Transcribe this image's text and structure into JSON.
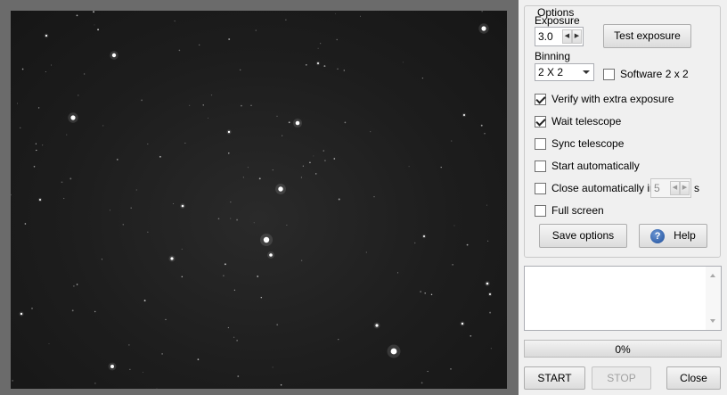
{
  "options": {
    "group_title": "Options",
    "exposure_label": "Exposure",
    "exposure_value": "3.0",
    "test_exposure_label": "Test exposure",
    "binning_label": "Binning",
    "binning_value": "2 X 2",
    "software_binning": {
      "label": "Software 2 x 2",
      "checked": false
    },
    "verify_extra": {
      "label": "Verify with extra exposure",
      "checked": true
    },
    "wait_telescope": {
      "label": "Wait telescope",
      "checked": true
    },
    "sync_telescope": {
      "label": "Sync telescope",
      "checked": false
    },
    "start_auto": {
      "label": "Start automatically",
      "checked": false
    },
    "close_auto": {
      "label": "Close automatically in",
      "checked": false,
      "seconds": "5",
      "unit": "s"
    },
    "full_screen": {
      "label": "Full screen",
      "checked": false
    },
    "save_options_label": "Save options",
    "help_label": "Help",
    "help_icon_glyph": "?"
  },
  "progress": {
    "text": "0%",
    "value": 0
  },
  "actions": {
    "start": "START",
    "stop": "STOP",
    "close": "Close"
  },
  "icons": {
    "help": "help-question-icon",
    "spin_up": "chevron-right-icon",
    "spin_down": "chevron-left-icon",
    "dropdown": "chevron-down-icon"
  }
}
